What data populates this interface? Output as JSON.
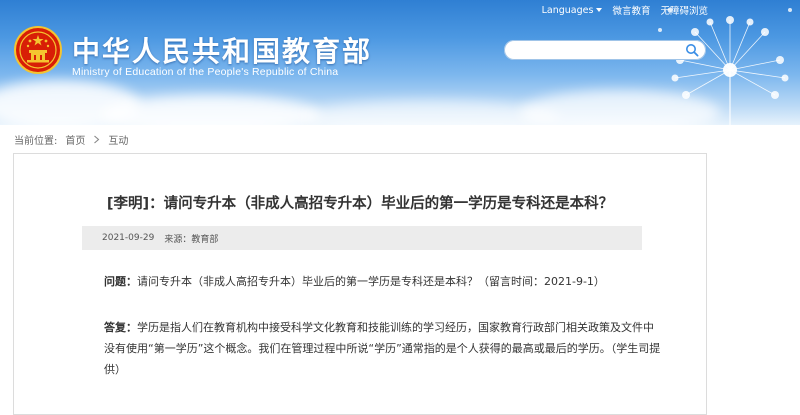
{
  "header": {
    "title_cn": "中华人民共和国教育部",
    "title_en": "Ministry of Education of the People's Republic of China",
    "links": {
      "languages": "Languages",
      "weibo": "微言教育",
      "accessibility": "无障碍浏览"
    },
    "search": {
      "placeholder": "",
      "value": ""
    }
  },
  "breadcrumb": {
    "label": "当前位置:",
    "items": [
      "首页",
      "互动"
    ]
  },
  "article": {
    "title": "[李明]：请问专升本（非成人高招专升本）毕业后的第一学历是专科还是本科？",
    "date": "2021-09-29",
    "source": "来源：教育部",
    "question_label": "问题：",
    "question_text": "请问专升本（非成人高招专升本）毕业后的第一学历是专科还是本科？（留言时间：2021-9-1）",
    "answer_label": "答复：",
    "answer_text": "学历是指人们在教育机构中接受科学文化教育和技能训练的学习经历，国家教育行政部门相关政策及文件中没有使用“第一学历”这个概念。我们在管理过程中所说“学历”通常指的是个人获得的最高或最后的学历。（学生司提供）"
  },
  "colors": {
    "header_top": "#2f7fd3",
    "header_bottom": "#e6f2fc",
    "meta_bar": "#ececec"
  },
  "icons": [
    "national-emblem-icon",
    "dandelion-decoration",
    "search-icon",
    "chevron-right-icon",
    "caret-down-icon"
  ]
}
